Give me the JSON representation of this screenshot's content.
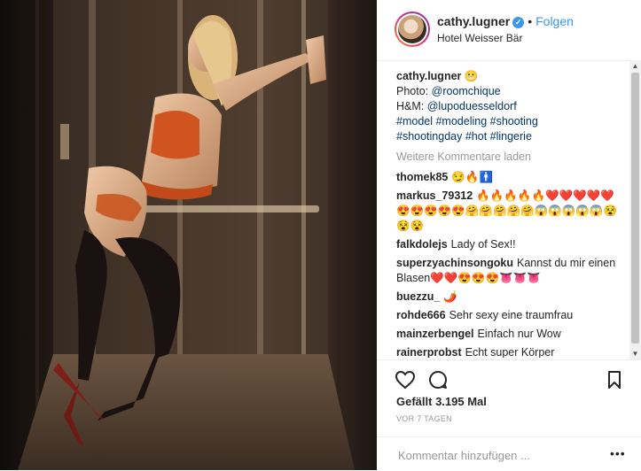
{
  "post": {
    "username": "cathy.lugner",
    "verified_icon": "verified-badge-icon",
    "separator": "•",
    "follow_label": "Folgen",
    "location": "Hotel Weisser Bär"
  },
  "caption": {
    "username": "cathy.lugner",
    "emoji": "😬",
    "photo_prefix": "Photo:",
    "photo_link": "@roomchique",
    "hm_prefix": "H&M:",
    "hm_link": "@lupoduesseldorf",
    "tags_line1": "#model #modeling #shooting",
    "tags_line2": "#shootingday #hot #lingerie"
  },
  "load_more": "Weitere Kommentare laden",
  "comments": [
    {
      "user": "thomek85",
      "text": "😏🔥🚹"
    },
    {
      "user": "markus_79312",
      "text": "🔥🔥🔥🔥🔥❤️❤️❤️❤️❤️😍😍😍😍😍🤗🤗🤗🤗🤗😱😱😱😱😱😵😵😵"
    },
    {
      "user": "falkdolejs",
      "text": "Lady of Sex!!"
    },
    {
      "user": "superzyachinsongoku",
      "text": "Kannst du mir einen Blasen❤️❤️😍😍😍👅👅👅"
    },
    {
      "user": "buezzu_",
      "text": "🌶️"
    },
    {
      "user": "rohde666",
      "text": "Sehr sexy eine traumfrau"
    },
    {
      "user": "mainzerbengel",
      "text": "Einfach nur Wow"
    },
    {
      "user": "rainerprobst",
      "text": "Echt super Körper"
    }
  ],
  "actions": {
    "like_icon": "heart-icon",
    "comment_icon": "comment-icon",
    "save_icon": "bookmark-icon"
  },
  "likes": "Gefällt 3.195 Mal",
  "age": "VOR 7 TAGEN",
  "comment_input": {
    "placeholder": "Kommentar hinzufügen ...",
    "value": ""
  },
  "options_label": "•••"
}
